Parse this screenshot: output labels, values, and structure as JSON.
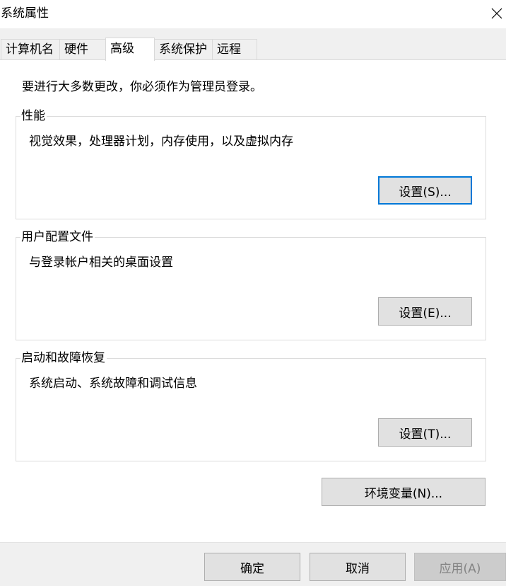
{
  "window": {
    "title": "系统属性",
    "close_icon": "close-icon"
  },
  "tabs": [
    {
      "label": "计算机名",
      "active": false
    },
    {
      "label": "硬件",
      "active": false
    },
    {
      "label": "高级",
      "active": true
    },
    {
      "label": "系统保护",
      "active": false
    },
    {
      "label": "远程",
      "active": false
    }
  ],
  "advanced": {
    "admin_note": "要进行大多数更改，你必须作为管理员登录。",
    "performance": {
      "title": "性能",
      "description": "视觉效果，处理器计划，内存使用，以及虚拟内存",
      "button": "设置(S)..."
    },
    "user_profiles": {
      "title": "用户配置文件",
      "description": "与登录帐户相关的桌面设置",
      "button": "设置(E)..."
    },
    "startup_recovery": {
      "title": "启动和故障恢复",
      "description": "系统启动、系统故障和调试信息",
      "button": "设置(T)..."
    },
    "env_button": "环境变量(N)..."
  },
  "footer": {
    "ok": "确定",
    "cancel": "取消",
    "apply": "应用(A)"
  },
  "colors": {
    "accent_focus": "#0078d7",
    "button_bg": "#e1e1e1",
    "tab_bg": "#f0f0f0"
  }
}
